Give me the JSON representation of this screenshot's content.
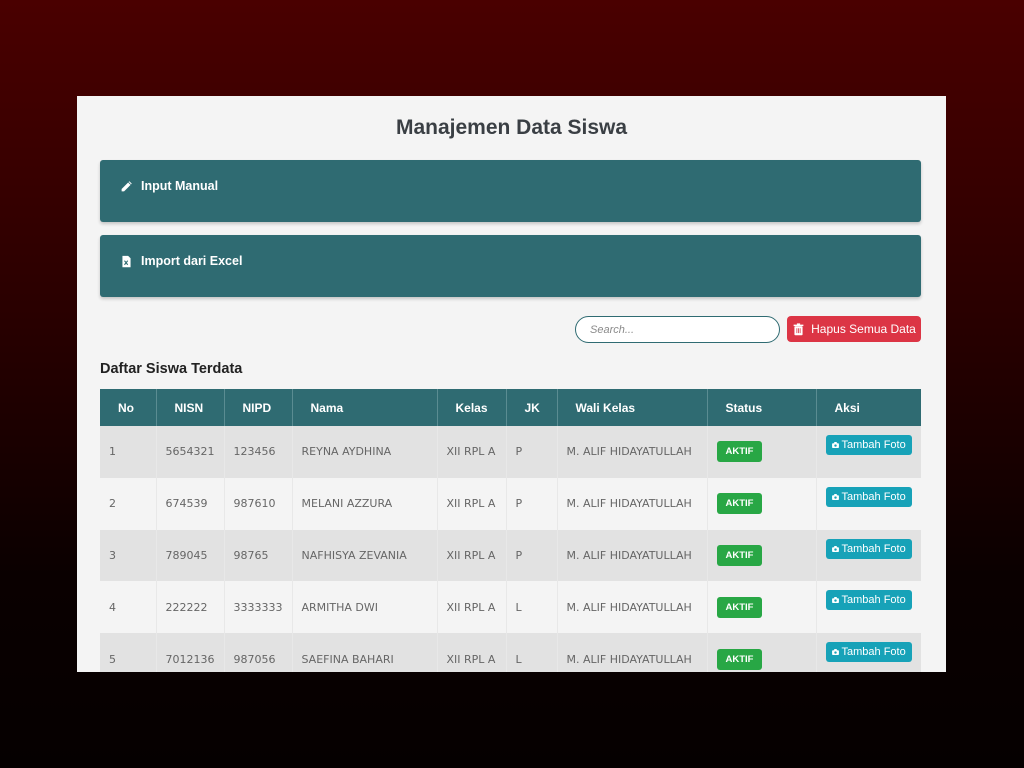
{
  "page": {
    "title": "Manajemen Data Siswa"
  },
  "sections": {
    "input_manual": {
      "label": "Input Manual",
      "icon": "pencil-icon"
    },
    "import_excel": {
      "label": "Import dari Excel",
      "icon": "excel-file-icon"
    }
  },
  "toolbar": {
    "search_placeholder": "Search...",
    "delete_all_label": "Hapus Semua Data",
    "delete_icon": "trash-icon",
    "delete_color": "#dc3545"
  },
  "list": {
    "heading": "Daftar Siswa Terdata",
    "columns": [
      "No",
      "NISN",
      "NIPD",
      "Nama",
      "Kelas",
      "JK",
      "Wali Kelas",
      "Status",
      "Aksi"
    ],
    "rows": [
      {
        "no": "1",
        "nisn": "5654321",
        "nipd": "123456",
        "nama": "REYNA AYDHINA",
        "kelas": "XII RPL A",
        "jk": "P",
        "wali": "M. ALIF HIDAYATULLAH",
        "status": "AKTIF",
        "action": "Tambah Foto"
      },
      {
        "no": "2",
        "nisn": "674539",
        "nipd": "987610",
        "nama": "MELANI AZZURA",
        "kelas": "XII RPL A",
        "jk": "P",
        "wali": "M. ALIF HIDAYATULLAH",
        "status": "AKTIF",
        "action": "Tambah Foto"
      },
      {
        "no": "3",
        "nisn": "789045",
        "nipd": "98765",
        "nama": "NAFHISYA ZEVANIA",
        "kelas": "XII RPL A",
        "jk": "P",
        "wali": "M. ALIF HIDAYATULLAH",
        "status": "AKTIF",
        "action": "Tambah Foto"
      },
      {
        "no": "4",
        "nisn": "222222",
        "nipd": "3333333",
        "nama": "ARMITHA DWI",
        "kelas": "XII RPL A",
        "jk": "L",
        "wali": "M. ALIF HIDAYATULLAH",
        "status": "AKTIF",
        "action": "Tambah Foto"
      },
      {
        "no": "5",
        "nisn": "7012136",
        "nipd": "987056",
        "nama": "SAEFINA BAHARI",
        "kelas": "XII RPL A",
        "jk": "L",
        "wali": "M. ALIF HIDAYATULLAH",
        "status": "AKTIF",
        "action": "Tambah Foto"
      }
    ]
  },
  "colors": {
    "primary": "#2f6b72",
    "status_active": "#28a745",
    "action_button": "#17a2b8",
    "danger": "#dc3545"
  }
}
